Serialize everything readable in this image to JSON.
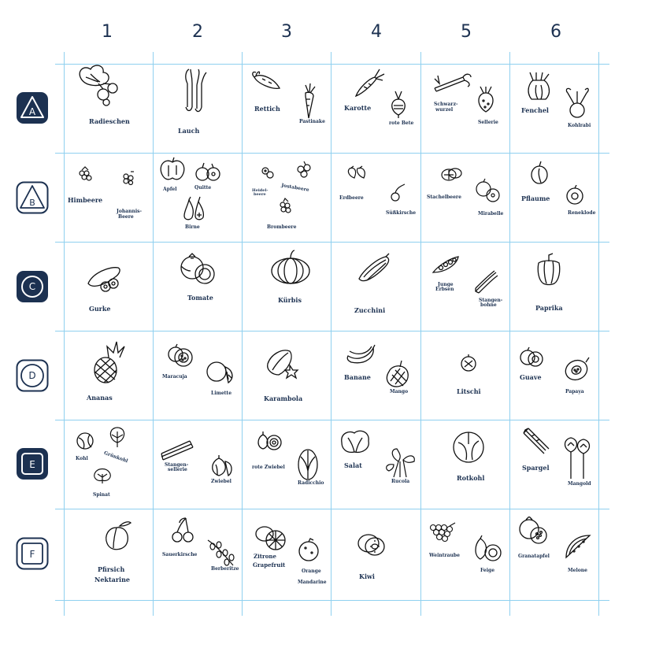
{
  "columns": [
    "1",
    "2",
    "3",
    "4",
    "5",
    "6"
  ],
  "rows": [
    "A",
    "B",
    "C",
    "D",
    "E",
    "F"
  ],
  "colors": {
    "accent": "#1c3151",
    "grid": "#8fd0ef"
  },
  "cells": {
    "A1": [
      "Radieschen"
    ],
    "A2": [
      "Lauch"
    ],
    "A3": [
      "Rettich",
      "Pastinake"
    ],
    "A4": [
      "Karotte",
      "rote Bete"
    ],
    "A5": [
      "Schwarz-",
      "wurzel",
      "Sellerie"
    ],
    "A6": [
      "Fenchel",
      "Kohlrabi"
    ],
    "B1": [
      "Himbeere",
      "Johannis-",
      "Beere"
    ],
    "B2": [
      "Apfel",
      "Quitte",
      "Birne"
    ],
    "B3": [
      "Heidel-",
      "beere",
      "Jostabeere",
      "Brombeere"
    ],
    "B4": [
      "Erdbeere",
      "Süßkirsche"
    ],
    "B5": [
      "Stachelbeere",
      "Mirabelle"
    ],
    "B6": [
      "Pflaume",
      "Reneklode"
    ],
    "C1": [
      "Gurke"
    ],
    "C2": [
      "Tomate"
    ],
    "C3": [
      "Kürbis"
    ],
    "C4": [
      "Zucchini"
    ],
    "C5": [
      "Junge",
      "Erbsen",
      "Stangen-",
      "bohne"
    ],
    "C6": [
      "Paprika"
    ],
    "D1": [
      "Ananas"
    ],
    "D2": [
      "Maracuja",
      "Limette"
    ],
    "D3": [
      "Karambola"
    ],
    "D4": [
      "Banane",
      "Mango"
    ],
    "D5": [
      "Litschi"
    ],
    "D6": [
      "Guave",
      "Papaya"
    ],
    "E1": [
      "Kohl",
      "Grünkohl",
      "Spinat"
    ],
    "E2": [
      "Stangen-",
      "sellerie",
      "Zwiebel"
    ],
    "E3": [
      "rote Zwiebel",
      "Radicchio"
    ],
    "E4": [
      "Salat",
      "Rucola"
    ],
    "E5": [
      "Rotkohl"
    ],
    "E6": [
      "Spargel",
      "Mangold"
    ],
    "F1": [
      "Pfirsich",
      "Nektarine"
    ],
    "F2": [
      "Sauerkirsche",
      "Berberitze"
    ],
    "F3": [
      "Zitrone",
      "Grapefruit",
      "Orange",
      "Mandarine"
    ],
    "F4": [
      "Kiwi"
    ],
    "F5": [
      "Weintraube",
      "Feige"
    ],
    "F6": [
      "Granatapfel",
      "Melone"
    ]
  }
}
